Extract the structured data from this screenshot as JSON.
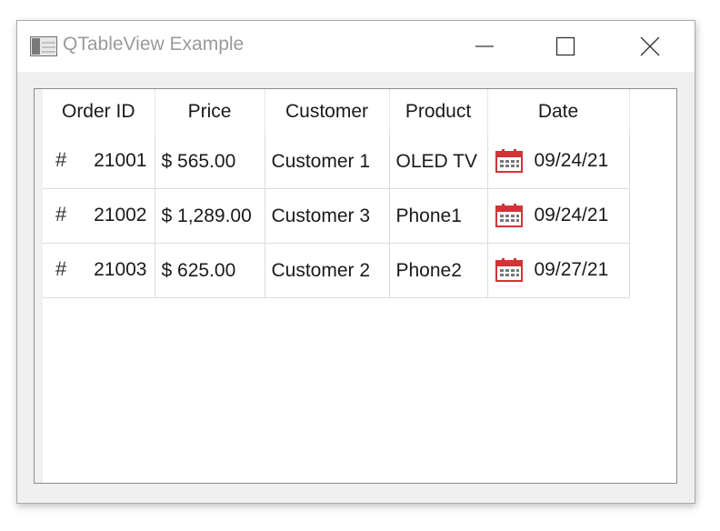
{
  "window": {
    "title": "QTableView Example"
  },
  "table": {
    "headers": [
      "Order ID",
      "Price",
      "Customer",
      "Product",
      "Date"
    ],
    "rows": [
      {
        "order_id": "21001",
        "price": "$ 565.00",
        "customer": "Customer 1",
        "product": "OLED TV",
        "date": "09/24/21"
      },
      {
        "order_id": "21002",
        "price": "$ 1,289.00",
        "customer": "Customer 3",
        "product": "Phone1",
        "date": "09/24/21"
      },
      {
        "order_id": "21003",
        "price": "$ 625.00",
        "customer": "Customer 2",
        "product": "Phone2",
        "date": "09/27/21"
      }
    ],
    "order_icon": "#",
    "date_icon": "calendar-icon"
  },
  "colors": {
    "calendar": "#d13438",
    "title_text": "#9a9a9a",
    "border": "#dcdcdc"
  }
}
